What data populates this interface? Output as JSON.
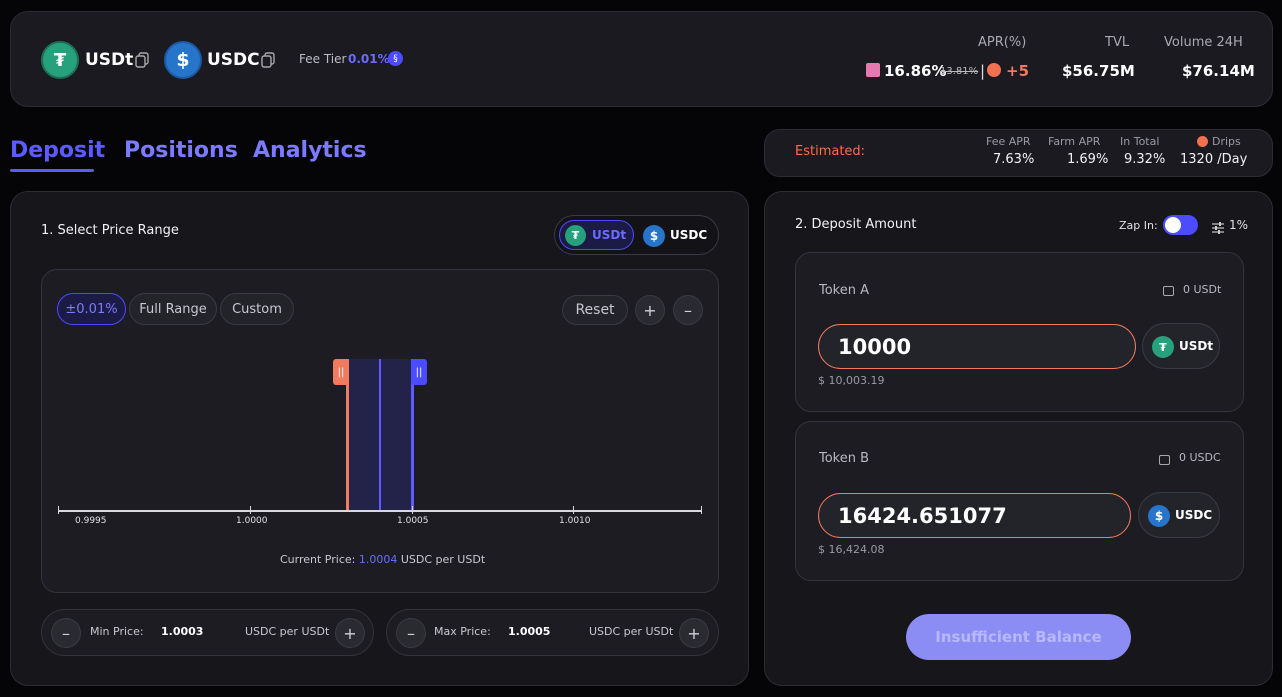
{
  "header": {
    "token_a": "USDt",
    "token_b": "USDC",
    "fee_tier_label": "Fee Tier",
    "fee_tier_value": "0.01%",
    "apr_label": "APR(%)",
    "apr_value": "16.86%",
    "apr_old": "13.81%",
    "apr_sep": "|",
    "apr_bonus": "+5",
    "tvl_label": "TVL",
    "tvl_value": "$56.75M",
    "volume_label": "Volume 24H",
    "volume_value": "$76.14M"
  },
  "tabs": [
    {
      "label": "Deposit",
      "active": true
    },
    {
      "label": "Positions",
      "active": false
    },
    {
      "label": "Analytics",
      "active": false
    }
  ],
  "estimated": {
    "label": "Estimated:",
    "fee_apr_label": "Fee APR",
    "fee_apr_value": "7.63%",
    "farm_apr_label": "Farm APR",
    "farm_apr_value": "1.69%",
    "total_label": "In Total",
    "total_value": "9.32%",
    "drips_label": "Drips",
    "drips_value": "1320 /Day"
  },
  "range": {
    "title": "1. Select Price Range",
    "toggle_a": "USDt",
    "toggle_b": "USDC",
    "presets": [
      "±0.01%",
      "Full Range",
      "Custom"
    ],
    "reset_label": "Reset",
    "zoom_in": "+",
    "zoom_out": "–",
    "ticks": [
      "0.9995",
      "1.0000",
      "1.0005",
      "1.0010"
    ],
    "current_price_label": "Current Price:",
    "current_price_value": "1.0004",
    "current_price_unit": "USDC per USDt",
    "min_label": "Min Price:",
    "min_value": "1.0003",
    "min_unit": "USDC per USDt",
    "max_label": "Max Price:",
    "max_value": "1.0005",
    "max_unit": "USDC per USDt",
    "minus": "–",
    "plus": "+"
  },
  "deposit": {
    "title": "2. Deposit Amount",
    "zap_label": "Zap In:",
    "slippage": "1%",
    "token_a_label": "Token A",
    "token_a_balance": "0 USDt",
    "token_a_amount": "10000",
    "token_a_usd": "$ 10,003.19",
    "token_a_symbol": "USDt",
    "token_b_label": "Token B",
    "token_b_balance": "0 USDC",
    "token_b_amount": "16424.651077",
    "token_b_usd": "$ 16,424.08",
    "token_b_symbol": "USDC",
    "submit_label": "Insufficient Balance"
  },
  "colors": {
    "accent": "#5b5bff",
    "tab_inactive": "#7b7bff",
    "orange": "#f27a5e",
    "red_label": "#ff6b4a",
    "submit_bg": "#8c8cf5"
  }
}
